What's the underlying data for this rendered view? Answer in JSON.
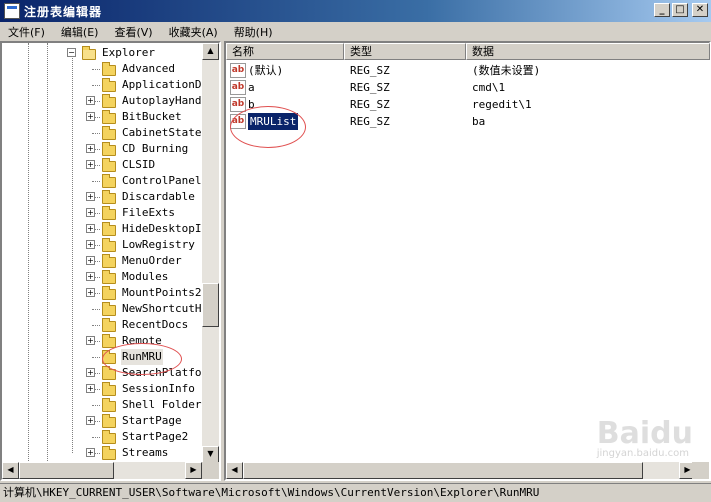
{
  "window": {
    "title": "注册表编辑器",
    "minimize_icon": "minimize-icon",
    "maximize_icon": "maximize-icon",
    "close_icon": "close-icon"
  },
  "menu": [
    "文件(F)",
    "编辑(E)",
    "查看(V)",
    "收藏夹(A)",
    "帮助(H)"
  ],
  "tree": {
    "parent": "Explorer",
    "children": [
      {
        "label": "Advanced",
        "expandable": false
      },
      {
        "label": "ApplicationDes",
        "expandable": false
      },
      {
        "label": "AutoplayHandle",
        "expandable": true
      },
      {
        "label": "BitBucket",
        "expandable": true
      },
      {
        "label": "CabinetState",
        "expandable": false
      },
      {
        "label": "CD Burning",
        "expandable": true
      },
      {
        "label": "CLSID",
        "expandable": true
      },
      {
        "label": "ControlPanel",
        "expandable": false
      },
      {
        "label": "Discardable",
        "expandable": true
      },
      {
        "label": "FileExts",
        "expandable": true
      },
      {
        "label": "HideDesktopIco",
        "expandable": true
      },
      {
        "label": "LowRegistry",
        "expandable": true
      },
      {
        "label": "MenuOrder",
        "expandable": true
      },
      {
        "label": "Modules",
        "expandable": true
      },
      {
        "label": "MountPoints2",
        "expandable": true
      },
      {
        "label": "NewShortcutHan",
        "expandable": false
      },
      {
        "label": "RecentDocs",
        "expandable": false
      },
      {
        "label": "Remote",
        "expandable": true
      },
      {
        "label": "RunMRU",
        "expandable": false,
        "selected": true
      },
      {
        "label": "SearchPlatform",
        "expandable": true
      },
      {
        "label": "SessionInfo",
        "expandable": true
      },
      {
        "label": "Shell Folders",
        "expandable": false
      },
      {
        "label": "StartPage",
        "expandable": true
      },
      {
        "label": "StartPage2",
        "expandable": false
      },
      {
        "label": "Streams",
        "expandable": true
      }
    ]
  },
  "list": {
    "columns": [
      "名称",
      "类型",
      "数据"
    ],
    "rows": [
      {
        "name": "(默认)",
        "type": "REG_SZ",
        "data": "(数值未设置)"
      },
      {
        "name": "a",
        "type": "REG_SZ",
        "data": "cmd\\1"
      },
      {
        "name": "b",
        "type": "REG_SZ",
        "data": "regedit\\1"
      },
      {
        "name": "MRUList",
        "type": "REG_SZ",
        "data": "ba",
        "selected": true
      }
    ]
  },
  "value_icon_text": "ab",
  "status_path": "计算机\\HKEY_CURRENT_USER\\Software\\Microsoft\\Windows\\CurrentVersion\\Explorer\\RunMRU",
  "watermark": {
    "main": "Baidu",
    "sub": "jingyan.baidu.com"
  },
  "colors": {
    "titlebar": "#0a246a",
    "selection": "#0a246a",
    "annotation_circle": "#e05050",
    "folder": "#f4d35e"
  }
}
